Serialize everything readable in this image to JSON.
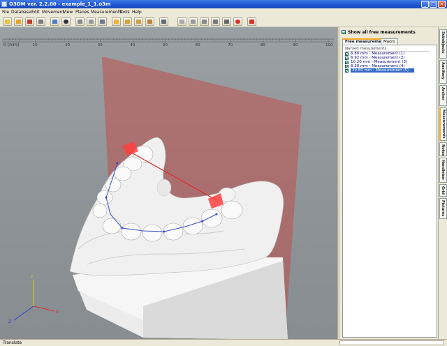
{
  "window": {
    "title": "O3DM ver. 2.2.00  - example_1_1.o3m"
  },
  "menu": [
    "File",
    "Database",
    "Edit",
    "Movement",
    "View",
    "Planes",
    "Measurements",
    "Tools",
    "Help"
  ],
  "toolbar_icons": [
    "new-icon",
    "open-icon",
    "save-icon",
    "print-icon",
    "tool-icon",
    "tooth-icon",
    "grid-icon",
    "layers-icon",
    "window-icon",
    "folder-icon",
    "camera-icon",
    "copy-icon",
    "export-icon",
    "ruler-icon",
    "slice-icon",
    "section-icon",
    "plane-icon",
    "arch-icon",
    "shield-icon",
    "target-icon"
  ],
  "ruler": {
    "unit_label": "0 [mm]",
    "ticks": [
      "10",
      "20",
      "30",
      "40",
      "50",
      "60",
      "70",
      "80",
      "90",
      "100"
    ]
  },
  "axes": {
    "x": "X",
    "y": "Y",
    "z": "Z"
  },
  "panel": {
    "show_all_label": "Show all free measurements",
    "tabs": [
      "Free measurements",
      "Macro"
    ],
    "group_label": "Named mesurements",
    "measurements": [
      {
        "label": "6.80 mm - Measurement (1)",
        "checked": true
      },
      {
        "label": "6.92 mm - Measurement (2)",
        "checked": true
      },
      {
        "label": "10.20 mm - Measurement (3)",
        "checked": true
      },
      {
        "label": "6.30 mm - Measurement (4)",
        "checked": true
      },
      {
        "label": "39.60 mm - Measurement (5)",
        "checked": true,
        "selected": true
      }
    ]
  },
  "side_tabs": [
    "Subobjects",
    "Auxiliary",
    "Archer",
    "Measurements",
    "Notes",
    "Handlebar",
    "Grid",
    "Pictures"
  ],
  "status": {
    "text": "Translate"
  },
  "colors": {
    "title_blue": "#2457d6",
    "selection": "#316ac5",
    "plane": "#c0504d",
    "viewport": "#8d9396"
  }
}
